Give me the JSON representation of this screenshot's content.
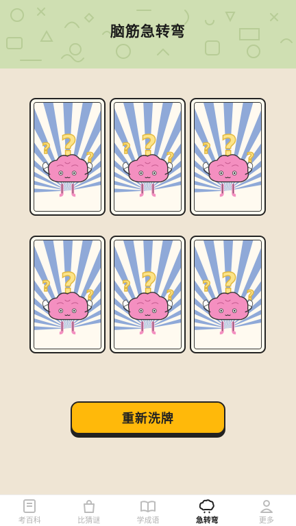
{
  "header": {
    "title": "脑筋急转弯"
  },
  "cards": [
    {
      "name": "card-1"
    },
    {
      "name": "card-2"
    },
    {
      "name": "card-3"
    },
    {
      "name": "card-4"
    },
    {
      "name": "card-5"
    },
    {
      "name": "card-6"
    }
  ],
  "actions": {
    "shuffle_label": "重新洗牌"
  },
  "tabbar": {
    "items": [
      {
        "label": "考百科",
        "icon": "book-icon"
      },
      {
        "label": "比猜谜",
        "icon": "bag-icon"
      },
      {
        "label": "学成语",
        "icon": "open-book-icon"
      },
      {
        "label": "急转弯",
        "icon": "brain-icon",
        "active": true
      },
      {
        "label": "更多",
        "icon": "person-icon"
      }
    ]
  },
  "colors": {
    "header_bg": "#cfdfb2",
    "page_bg": "#efe5d4",
    "button": "#ffb90a",
    "card_rays": "#8fa9d8",
    "brain": "#f48fc0",
    "question_mark": "#fce48a"
  }
}
